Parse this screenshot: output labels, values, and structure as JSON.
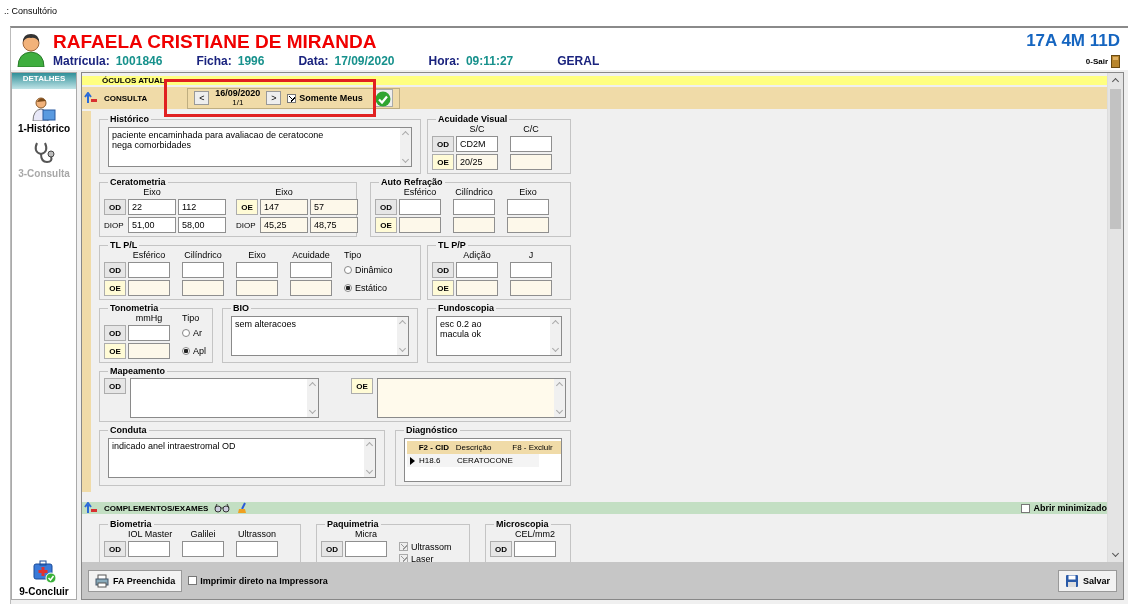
{
  "window": {
    "title": ".: Consultório"
  },
  "patient": {
    "name": "RAFAELA CRISTIANE DE MIRANDA",
    "fields": [
      {
        "label": "Matrícula:",
        "value": "1001846"
      },
      {
        "label": "Ficha:",
        "value": "1996"
      },
      {
        "label": "Data:",
        "value": "17/09/2020"
      },
      {
        "label": "Hora:",
        "value": "09:11:27"
      }
    ],
    "sector": "GERAL",
    "age": "17A 4M 11D",
    "exit": "0-Sair"
  },
  "sidebar": {
    "header": "DETALHES",
    "items": [
      {
        "kind": "history",
        "label": "1-Histórico",
        "disabled": false
      },
      {
        "kind": "consult",
        "label": "3-Consulta",
        "disabled": true
      }
    ],
    "footer": {
      "kind": "finish",
      "label": "9-Concluir"
    }
  },
  "oculos": {
    "title": "ÓCULOS ATUAL"
  },
  "consulta": {
    "title": "CONSULTA",
    "navigator": {
      "prev": "<",
      "date": "16/09/2020",
      "page": "1/1",
      "next": ">",
      "filter": {
        "label": "Somente Meus",
        "checked": true
      }
    },
    "rows": [
      {
        "groups": [
          {
            "kind": "notes",
            "title": "Histórico",
            "text": "paciente encaminhada para avaliacao de ceratocone\nnega comorbidades"
          },
          {
            "kind": "grid",
            "title": "Acuidade Visual",
            "columns": [
              "S/C",
              "C/C"
            ],
            "rows": [
              {
                "eye": "OD",
                "values": [
                  "CD2M"
                ]
              },
              {
                "eye": "OE",
                "values": [
                  "20/25"
                ]
              }
            ]
          }
        ]
      },
      {
        "groups": [
          {
            "kind": "kerato",
            "title": "Ceratometria",
            "sides": [
              {
                "eye": "OD",
                "header": "Eixo",
                "values": [
                  "22",
                  "112"
                ],
                "diop_label": "DIOP",
                "diop": [
                  "51,00",
                  "58,00"
                ]
              },
              {
                "eye": "OE",
                "header": "Eixo",
                "values": [
                  "147",
                  "57"
                ],
                "diop_label": "DIOP",
                "diop": [
                  "45,25",
                  "48,75"
                ]
              }
            ]
          },
          {
            "kind": "grid",
            "title": "Auto Refração",
            "columns": [
              "Esférico",
              "Cilíndrico",
              "Eixo"
            ],
            "rows": [
              {
                "eye": "OD"
              },
              {
                "eye": "OE"
              }
            ]
          }
        ]
      },
      {
        "groups": [
          {
            "kind": "grid",
            "title": "TL P/L",
            "columns": [
              "Esférico",
              "Cilíndrico",
              "Eixo",
              "Acuidade"
            ],
            "rows": [
              {
                "eye": "OD"
              },
              {
                "eye": "OE"
              }
            ],
            "options": {
              "label": "Tipo",
              "items": [
                {
                  "label": "Dinâmico",
                  "selected": false
                },
                {
                  "label": "Estático",
                  "selected": true
                }
              ]
            }
          },
          {
            "kind": "grid",
            "title": "TL P/P",
            "columns": [
              "Adição",
              "J"
            ],
            "rows": [
              {
                "eye": "OD"
              },
              {
                "eye": "OE"
              }
            ]
          }
        ]
      },
      {
        "groups": [
          {
            "kind": "grid",
            "title": "Tonometria",
            "columns": [
              "mmHg"
            ],
            "rows": [
              {
                "eye": "OD"
              },
              {
                "eye": "OE"
              }
            ],
            "options": {
              "label": "Tipo",
              "items": [
                {
                  "label": "Ar",
                  "selected": false
                },
                {
                  "label": "Apl",
                  "selected": true
                }
              ]
            }
          },
          {
            "kind": "notes",
            "title": "BIO",
            "text": "sem alteracoes"
          },
          {
            "kind": "notes",
            "title": "Fundoscopia",
            "text": "esc 0.2 ao\nmacula ok"
          }
        ]
      },
      {
        "groups": [
          {
            "kind": "eye_notes",
            "title": "Mapeamento",
            "items": [
              {
                "eye": "OD"
              },
              {
                "eye": "OE"
              }
            ]
          }
        ]
      },
      {
        "groups": [
          {
            "kind": "notes",
            "title": "Conduta",
            "text": "indicado anel intraestromal OD"
          },
          {
            "kind": "table",
            "title": "Diagnóstico",
            "columns": [
              "F2 - CID",
              "Descrição",
              "F8 - Excluir"
            ],
            "rows": [
              {
                "cells": [
                  "H18.6",
                  "CERATOCONE"
                ],
                "current": true
              }
            ]
          }
        ]
      }
    ]
  },
  "complementos": {
    "title": "COMPLEMENTOS/EXAMES",
    "minimize": {
      "label": "Abrir minimizado",
      "checked": false
    },
    "rows": [
      {
        "groups": [
          {
            "kind": "grid",
            "title": "Biometria",
            "columns": [
              "IOL Master",
              "Galilei",
              "Ultrasson"
            ],
            "rows": [
              {
                "eye": "OD"
              }
            ]
          },
          {
            "kind": "grid",
            "title": "Paquimetria",
            "columns": [
              "Micra"
            ],
            "rows": [
              {
                "eye": "OD"
              }
            ],
            "checks": [
              {
                "label": "Ultrassom",
                "checked": true,
                "disabled": true
              },
              {
                "label": "Laser",
                "checked": true,
                "disabled": true
              }
            ]
          },
          {
            "kind": "grid",
            "title": "Microscopia",
            "columns": [
              "CEL/mm2"
            ],
            "rows": [
              {
                "eye": "OD"
              }
            ]
          }
        ]
      }
    ]
  },
  "footer": {
    "fa_button": "FA Preenchida",
    "print": {
      "label": "Imprimir direto na Impressora",
      "checked": false
    },
    "save": "Salvar"
  }
}
